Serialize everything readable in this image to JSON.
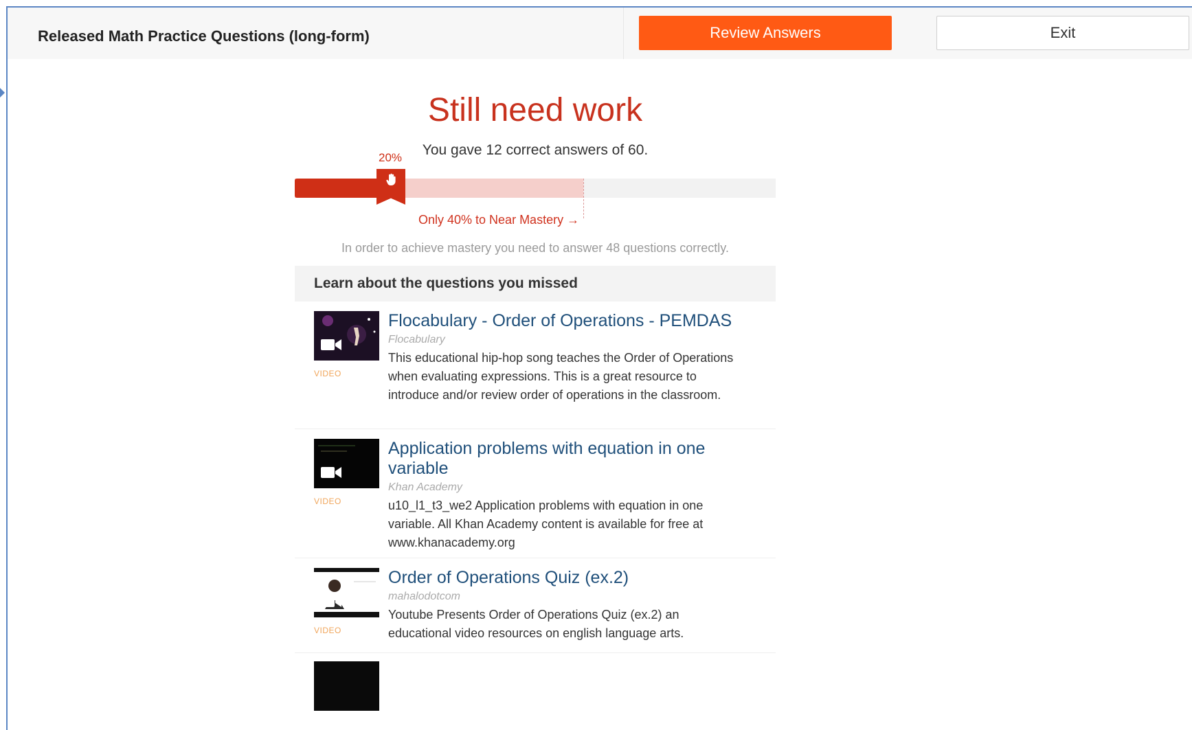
{
  "header": {
    "title": "Released Math Practice Questions (long-form)",
    "review_label": "Review Answers",
    "exit_label": "Exit"
  },
  "result": {
    "title": "Still need work",
    "summary": "You gave 12 correct answers of 60.",
    "current_label": "20%",
    "current_fraction": 0.2,
    "target_fraction": 0.6,
    "target_text": "Only 40% to Near Mastery →",
    "mastery_note": "In order to achieve mastery you need to answer 48 questions correctly."
  },
  "colors": {
    "accent": "#ff5a14",
    "progress": "#cf2f16",
    "target": "#f5cfcb",
    "link": "#1f4f7a"
  },
  "learn": {
    "heading": "Learn about the questions you missed",
    "resources": [
      {
        "title": "Flocabulary - Order of Operations - PEMDAS",
        "source": "Flocabulary",
        "kind": "VIDEO",
        "description": "This educational hip-hop song teaches the Order of Operations when evaluating expressions. This is a great resource to introduce and/or review order of operations in the classroom."
      },
      {
        "title": "Application problems with equation in one variable",
        "source": "Khan Academy",
        "kind": "VIDEO",
        "description": "u10_l1_t3_we2 Application problems with equation in one variable. All Khan Academy content is available for free at www.khanacademy.org"
      },
      {
        "title": "Order of Operations Quiz (ex.2)",
        "source": "mahalodotcom",
        "kind": "VIDEO",
        "description": "Youtube Presents Order of Operations Quiz (ex.2) an educational video resources on english language arts."
      }
    ]
  }
}
